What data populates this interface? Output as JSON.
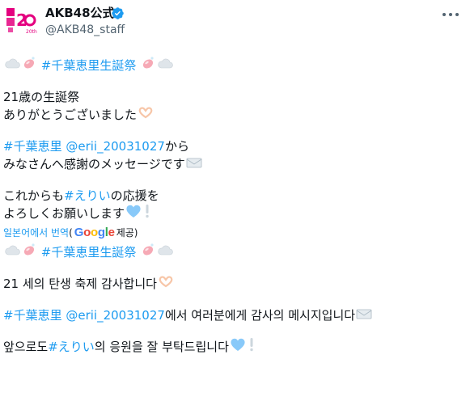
{
  "account": {
    "display_name": "AKB48公式",
    "handle": "@AKB48_staff",
    "avatar_badge": "20th",
    "verified_color": "#1d9bf0"
  },
  "original": {
    "hashtag_birthday": "#千葉恵里生誕祭",
    "line_age": "21歳の生誕祭",
    "line_thanks": "ありがとうございました",
    "hashtag_member": "#千葉恵里",
    "mention": "@erii_20031027",
    "from_suffix": " から",
    "line_message": "みなさんへ感謝のメッセージです",
    "support_prefix": "これからも ",
    "hashtag_nickname": "#えりい",
    "support_suffix": " の応援を",
    "line_regards": "よろしくお願いします"
  },
  "translate": {
    "label": "일본어에서 번역",
    "paren_open": "(",
    "provider": "Google",
    "paren_close": " 제공)"
  },
  "translated": {
    "hashtag_birthday": "#千葉恵里生誕祭",
    "line_age": "21 세의 탄생 축제 감사합니다 ",
    "hashtag_member": "#千葉恵里",
    "mention": "@erii_20031027",
    "message": " 에서 여러분에게 감사의 메시지입니다 ",
    "support_prefix": "앞으로도 ",
    "hashtag_nickname": "#えりい",
    "support_suffix": " 의 응원을 잘 부탁드립니다 "
  },
  "icons": {
    "emoji_cloud": "cloud-emoji",
    "emoji_soap": "soap-emoji",
    "emoji_hands": "heart-hands-emoji",
    "emoji_envelope": "envelope-emoji",
    "emoji_heart": "light-blue-heart-emoji",
    "emoji_exclaim": "white-exclamation-emoji"
  },
  "colors": {
    "link": "#1d9bf0",
    "text": "#0f1419",
    "secondary": "#536471",
    "avatar_pink": "#e4007f"
  }
}
